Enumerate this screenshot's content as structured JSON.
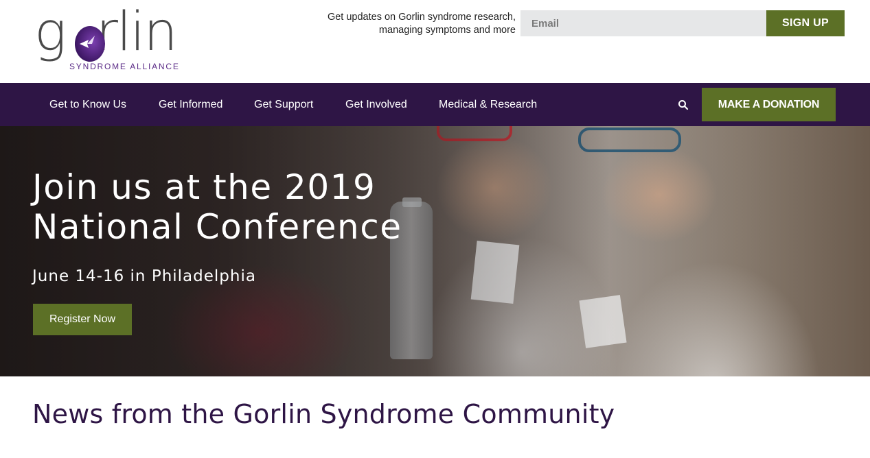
{
  "logo": {
    "word": "gorlin",
    "tagline": "SYNDROME ALLIANCE",
    "icon": "gorlin-o-mark"
  },
  "signup": {
    "text": "Get updates on Gorlin syndrome research, managing symptoms and more",
    "email_placeholder": "Email",
    "button_label": "SIGN UP"
  },
  "nav": {
    "items": [
      {
        "label": "Get to Know Us"
      },
      {
        "label": "Get Informed"
      },
      {
        "label": "Get Support"
      },
      {
        "label": "Get Involved"
      },
      {
        "label": "Medical & Research"
      }
    ],
    "search_icon": "search-icon",
    "donate_label": "MAKE A DONATION"
  },
  "hero": {
    "title": "Join us at the 2019 National Conference",
    "subtitle": "June 14-16 in Philadelphia",
    "cta_label": "Register Now"
  },
  "news": {
    "title": "News from the Gorlin Syndrome Community"
  },
  "colors": {
    "brand_purple": "#2e1545",
    "accent_green": "#5c7026",
    "logo_purple": "#5a2a86"
  }
}
